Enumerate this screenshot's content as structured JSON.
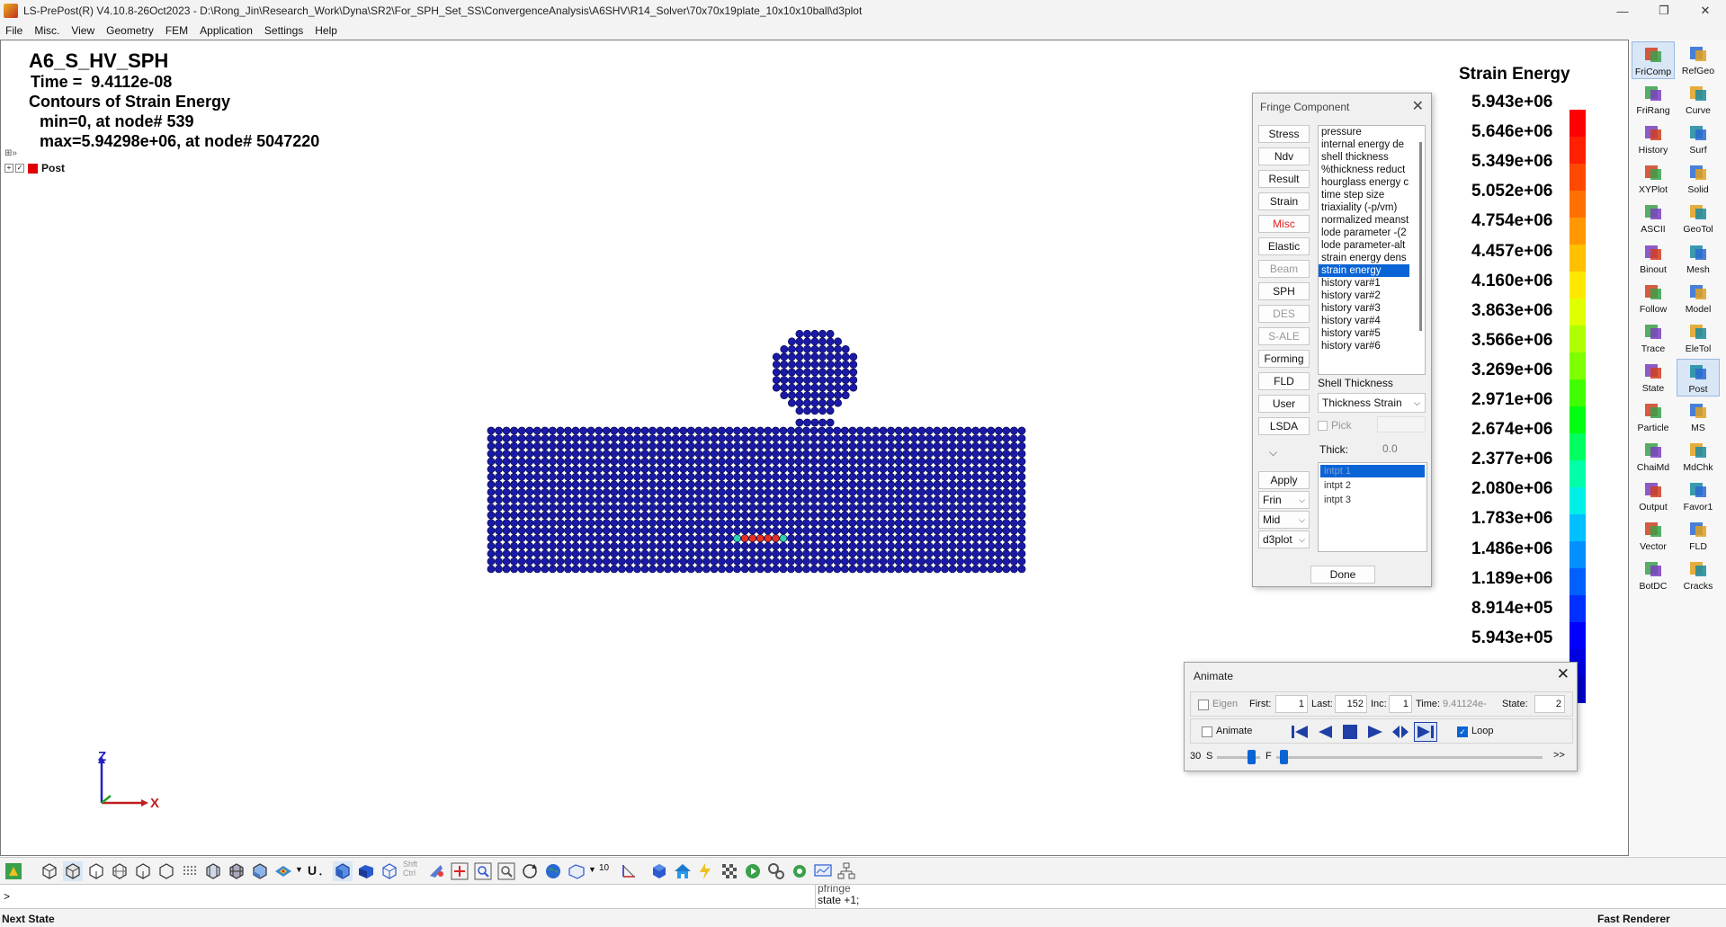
{
  "window": {
    "title": "LS-PrePost(R) V4.10.8-26Oct2023 - D:\\Rong_Jin\\Research_Work\\Dyna\\SR2\\For_SPH_Set_SS\\ConvergenceAnalysis\\A6SHV\\R14_Solver\\70x70x19plate_10x10x10ball\\d3plot",
    "minimize": "—",
    "maximize": "❐",
    "close": "✕"
  },
  "menu": [
    "File",
    "Misc.",
    "View",
    "Geometry",
    "FEM",
    "Application",
    "Settings",
    "Help"
  ],
  "viewport": {
    "model_title": "A6_S_HV_SPH",
    "time_label": "Time =  9.4112e-08",
    "contour_label": "Contours of Strain Energy",
    "min_label": " min=0, at node# 539",
    "max_label": " max=5.94298e+06, at node# 5047220",
    "tree_item": "Post",
    "axis_z": "Z",
    "axis_x": "X"
  },
  "legend": {
    "title": "Strain Energy",
    "ticks": [
      "5.943e+06",
      "5.646e+06",
      "5.349e+06",
      "5.052e+06",
      "4.754e+06",
      "4.457e+06",
      "4.160e+06",
      "3.863e+06",
      "3.566e+06",
      "3.269e+06",
      "2.971e+06",
      "2.674e+06",
      "2.377e+06",
      "2.080e+06",
      "1.783e+06",
      "1.486e+06",
      "1.189e+06",
      "8.914e+05",
      "5.943e+05"
    ],
    "colors": [
      "#ff0000",
      "#ff2000",
      "#ff4800",
      "#ff7000",
      "#ff9800",
      "#ffc000",
      "#ffe800",
      "#e0ff00",
      "#b0ff00",
      "#80ff00",
      "#40ff00",
      "#00ff10",
      "#00ff60",
      "#00ffa8",
      "#00f0e8",
      "#00c0ff",
      "#0090ff",
      "#0060ff",
      "#0030ff",
      "#0000ff",
      "#0000e0",
      "#0000c8"
    ]
  },
  "fringe": {
    "title": "Fringe Component",
    "close": "✕",
    "buttons": [
      {
        "label": "Stress",
        "state": "normal"
      },
      {
        "label": "Ndv",
        "state": "normal"
      },
      {
        "label": "Result",
        "state": "normal"
      },
      {
        "label": "Strain",
        "state": "normal"
      },
      {
        "label": "Misc",
        "state": "active"
      },
      {
        "label": "Elastic",
        "state": "normal"
      },
      {
        "label": "Beam",
        "state": "disabled"
      },
      {
        "label": "SPH",
        "state": "normal"
      },
      {
        "label": "DES",
        "state": "disabled"
      },
      {
        "label": "S-ALE",
        "state": "disabled"
      },
      {
        "label": "Forming",
        "state": "normal"
      },
      {
        "label": "FLD",
        "state": "normal"
      },
      {
        "label": "User",
        "state": "normal"
      },
      {
        "label": "LSDA",
        "state": "normal"
      }
    ],
    "list_items": [
      "pressure",
      "internal energy de",
      "shell thickness",
      "%thickness reduct",
      "hourglass energy c",
      "time step size",
      "triaxiality (-p/vm)",
      "normalized meanst",
      "lode parameter -(2",
      "lode parameter-alt",
      "strain energy dens",
      "strain energy",
      "history var#1",
      "history var#2",
      "history var#3",
      "history var#4",
      "history var#5",
      "history var#6"
    ],
    "selected_item": "strain energy",
    "shell_label": "Shell Thickness",
    "shell_select": "Thickness Strain",
    "pick_label": "Pick",
    "thick_label": "Thick:",
    "thick_value": "0.0",
    "intpt_items": [
      "intpt   1",
      "intpt   2",
      "intpt   3"
    ],
    "apply": "Apply",
    "drop1": "Frin",
    "drop2": "Mid",
    "drop3": "d3plot",
    "done": "Done"
  },
  "animate": {
    "title": "Animate",
    "close": "✕",
    "eigen_label": "Eigen",
    "first_label": "First:",
    "first_value": "1",
    "last_label": "Last:",
    "last_value": "152",
    "inc_label": "Inc:",
    "inc_value": "1",
    "time_label": "Time:",
    "time_value": "9.41124e-",
    "state_label": "State:",
    "state_value": "2",
    "animate_label": "Animate",
    "loop_label": "Loop",
    "speed_label": "30",
    "s_label": "S",
    "f_label": "F",
    "more_label": ">>"
  },
  "right_toolbar": [
    {
      "label": "FriComp",
      "icon": "fricomp-icon",
      "active": true
    },
    {
      "label": "RefGeo",
      "icon": "refgeo-icon",
      "active": false
    },
    {
      "label": "FriRang",
      "icon": "frirang-icon",
      "active": false
    },
    {
      "label": "Curve",
      "icon": "curve-icon",
      "active": false
    },
    {
      "label": "History",
      "icon": "history-icon",
      "active": false
    },
    {
      "label": "Surf",
      "icon": "surf-icon",
      "active": false
    },
    {
      "label": "XYPlot",
      "icon": "xyplot-icon",
      "active": false
    },
    {
      "label": "Solid",
      "icon": "solid-icon",
      "active": false
    },
    {
      "label": "ASCII",
      "icon": "ascii-icon",
      "active": false
    },
    {
      "label": "GeoTol",
      "icon": "geotol-icon",
      "active": false
    },
    {
      "label": "Binout",
      "icon": "binout-icon",
      "active": false
    },
    {
      "label": "Mesh",
      "icon": "mesh-icon",
      "active": false
    },
    {
      "label": "Follow",
      "icon": "follow-icon",
      "active": false
    },
    {
      "label": "Model",
      "icon": "model-icon",
      "active": false
    },
    {
      "label": "Trace",
      "icon": "trace-icon",
      "active": false
    },
    {
      "label": "EleTol",
      "icon": "eletol-icon",
      "active": false
    },
    {
      "label": "State",
      "icon": "state-icon",
      "active": false
    },
    {
      "label": "Post",
      "icon": "post-icon",
      "active": true
    },
    {
      "label": "Particle",
      "icon": "particle-icon",
      "active": false
    },
    {
      "label": "MS",
      "icon": "ms-icon",
      "active": false
    },
    {
      "label": "ChaiMd",
      "icon": "chaimd-icon",
      "active": false
    },
    {
      "label": "MdChk",
      "icon": "mdchk-icon",
      "active": false
    },
    {
      "label": "Output",
      "icon": "output-icon",
      "active": false
    },
    {
      "label": "Favor1",
      "icon": "favor1-icon",
      "active": false
    },
    {
      "label": "Vector",
      "icon": "vector-icon",
      "active": false
    },
    {
      "label": "FLD",
      "icon": "fld-icon",
      "active": false
    },
    {
      "label": "BotDC",
      "icon": "botdc-icon",
      "active": false
    },
    {
      "label": "Cracks",
      "icon": "cracks-icon",
      "active": false
    }
  ],
  "bottom_toolbar": {
    "u_label": "U",
    "shft_label": "Shft",
    "ctrl_label": "Ctrl",
    "num_label": "10"
  },
  "command": {
    "prompt": ">",
    "history_old": "pfringe",
    "history_last": "state +1;"
  },
  "status": {
    "left": "Next State",
    "right": "Fast Renderer"
  }
}
